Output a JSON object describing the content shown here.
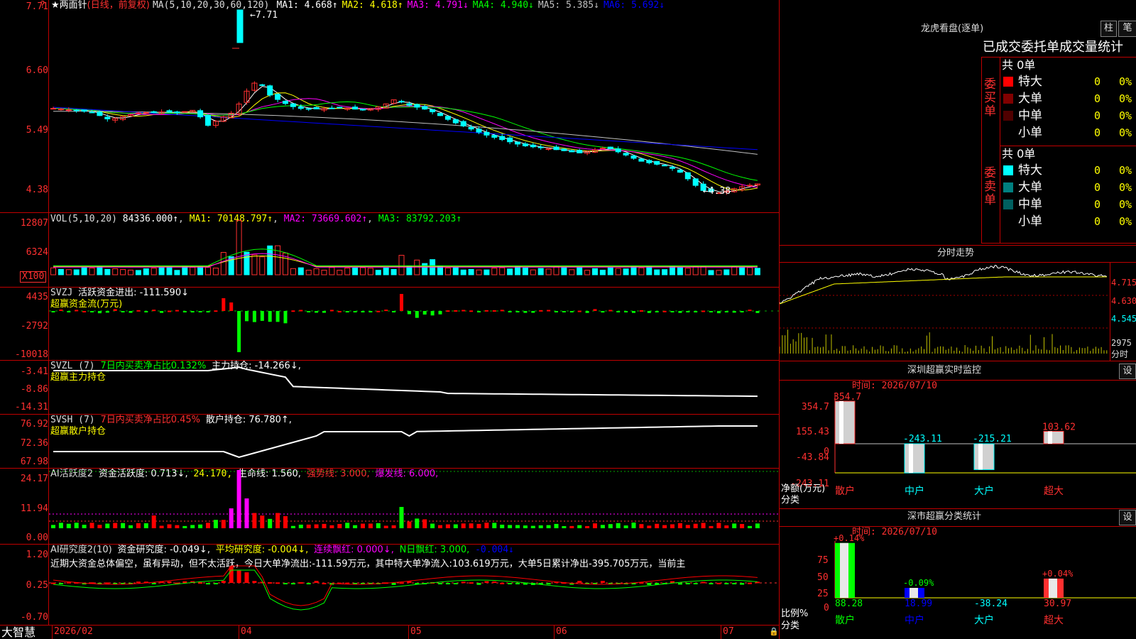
{
  "colors": {
    "up": "#ff3030",
    "down": "#00ffff",
    "ma1": "#ffffff",
    "ma2": "#ffff00",
    "ma3": "#ff00ff",
    "ma4": "#00ff00",
    "ma5": "#c0c0c0",
    "ma6": "#0000ff"
  },
  "price_panel": {
    "star": "★",
    "name": "两面针",
    "mode": "(日线，前复权)",
    "ma_params": "MA(5,10,20,30,60,120)",
    "ma_labels": [
      {
        "text": "MA1: 4.668↑",
        "color": "#ffffff"
      },
      {
        "text": "MA2: 4.618↑",
        "color": "#ffff00"
      },
      {
        "text": "MA3: 4.791↓",
        "color": "#ff00ff"
      },
      {
        "text": "MA4: 4.940↓",
        "color": "#00ff00"
      },
      {
        "text": "MA5: 5.385↓",
        "color": "#c0c0c0"
      },
      {
        "text": "MA6: 5.692↓",
        "color": "#0000ff"
      }
    ],
    "y_ticks": [
      "7.71",
      "6.60",
      "5.49",
      "4.38"
    ],
    "high_marker": "7.71",
    "low_marker": "4.38",
    "corner_mark": "?"
  },
  "vol_panel": {
    "title": "VOL(5,10,20)",
    "value": "84336.000↑",
    "ma1": "MA1: 70148.797↑",
    "ma2": "MA2: 73669.602↑",
    "ma3": "MA3: 83792.203↑",
    "y_ticks": [
      "12807",
      "6324"
    ],
    "unit": "X100"
  },
  "svzj_panel": {
    "title": "SVZJ",
    "label": "活跃资金进出: -111.590↓",
    "sub": "超赢资金流(万元)",
    "y_ticks": [
      "4435",
      "-2792",
      "-10018"
    ]
  },
  "svzl_panel": {
    "title": "SVZL (7)",
    "pct": "7日内买卖净占比0.132%",
    "label": "主力持仓: -14.266↓,",
    "sub": "超赢主力持仓",
    "y_ticks": [
      "-3.41",
      "-8.86",
      "-14.31"
    ]
  },
  "svsh_panel": {
    "title": "SVSH (7)",
    "pct": "7日内买卖净占比0.45%",
    "label": "散户持仓: 76.780↑,",
    "sub": "超赢散户持仓",
    "y_ticks": [
      "76.92",
      "72.36",
      "67.98"
    ]
  },
  "ai_active_panel": {
    "title": "AI活跃度2",
    "l1": "资金活跃度: 0.713↓,",
    "l2": "24.170,",
    "l3": "生命线: 1.560,",
    "l4": "强势线: 3.000,",
    "l5": "爆发线: 6.000,",
    "y_ticks": [
      "24.17",
      "11.94",
      "0.00"
    ]
  },
  "ai_research_panel": {
    "title": "AI研究度2(10)",
    "l1": "资金研究度: -0.049↓,",
    "l2": "平均研究度: -0.004↓,",
    "l3": "连续飘红: 0.000↓,",
    "l4": "N日飘红: 3.000,",
    "l5": "-0.004↓",
    "comment": "近期大资金总体偏空，虽有异动，但不太活跃，今日大单净流出:-111.59万元，其中特大单净流入:103.619万元，大单5日累计净出-395.705万元，当前主",
    "y_ticks": [
      "1.20",
      "0.25",
      "-0.70"
    ]
  },
  "date_axis": {
    "brand": "大智慧",
    "labels": [
      "2026/02",
      "04",
      "05",
      "06",
      "07"
    ]
  },
  "dragon_tiger": {
    "title": "龙虎看盘(逐单)",
    "btn1": "柱",
    "btn2": "笔",
    "heading": "已成交委托单成交量统计",
    "buy": {
      "side": "委买单",
      "total": "共 0单",
      "rows": [
        {
          "label": "特大",
          "n": "0",
          "pct": "0%",
          "color": "#ff0000"
        },
        {
          "label": "大单",
          "n": "0",
          "pct": "0%",
          "color": "#800000"
        },
        {
          "label": "中单",
          "n": "0",
          "pct": "0%",
          "color": "#500000"
        },
        {
          "label": "小单",
          "n": "0",
          "pct": "0%",
          "color": "#000000"
        }
      ]
    },
    "sell": {
      "side": "委卖单",
      "total": "共 0单",
      "rows": [
        {
          "label": "特大",
          "n": "0",
          "pct": "0%",
          "color": "#00ffff"
        },
        {
          "label": "大单",
          "n": "0",
          "pct": "0%",
          "color": "#008080"
        },
        {
          "label": "中单",
          "n": "0",
          "pct": "0%",
          "color": "#006060"
        },
        {
          "label": "小单",
          "n": "0",
          "pct": "0%",
          "color": "#000000"
        }
      ]
    }
  },
  "intraday": {
    "title": "分时走势",
    "y_ticks": [
      "4.715",
      "4.630",
      "4.545"
    ],
    "vol_tick": "2975",
    "vol_label": "分时"
  },
  "monitor": {
    "title": "深圳超赢实时监控",
    "btn": "设",
    "time": "时间: 2026/07/10",
    "y_ticks": [
      "354.7",
      "155.43",
      "0",
      "-43.84",
      "-243.11"
    ],
    "y_label1": "净额(万元)",
    "y_label2": "分类",
    "bars": [
      {
        "cat": "散户",
        "value": "354.7"
      },
      {
        "cat": "中户",
        "value": "-243.11"
      },
      {
        "cat": "大户",
        "value": "-215.21"
      },
      {
        "cat": "超大",
        "value": "103.62"
      }
    ]
  },
  "classify": {
    "title": "深市超赢分类统计",
    "btn": "设",
    "time": "时间: 2026/07/10",
    "y_ticks": [
      "75",
      "50",
      "25",
      "0"
    ],
    "y_label1": "比例%",
    "y_label2": "分类",
    "bars": [
      {
        "cat": "散户",
        "pct": "+0.14%",
        "value": "88.28"
      },
      {
        "cat": "中户",
        "pct": "-0.09%",
        "value": "18.99"
      },
      {
        "cat": "大户",
        "pct": "",
        "value": "-38.24"
      },
      {
        "cat": "超大",
        "pct": "+0.04%",
        "value": "30.97"
      }
    ]
  }
}
